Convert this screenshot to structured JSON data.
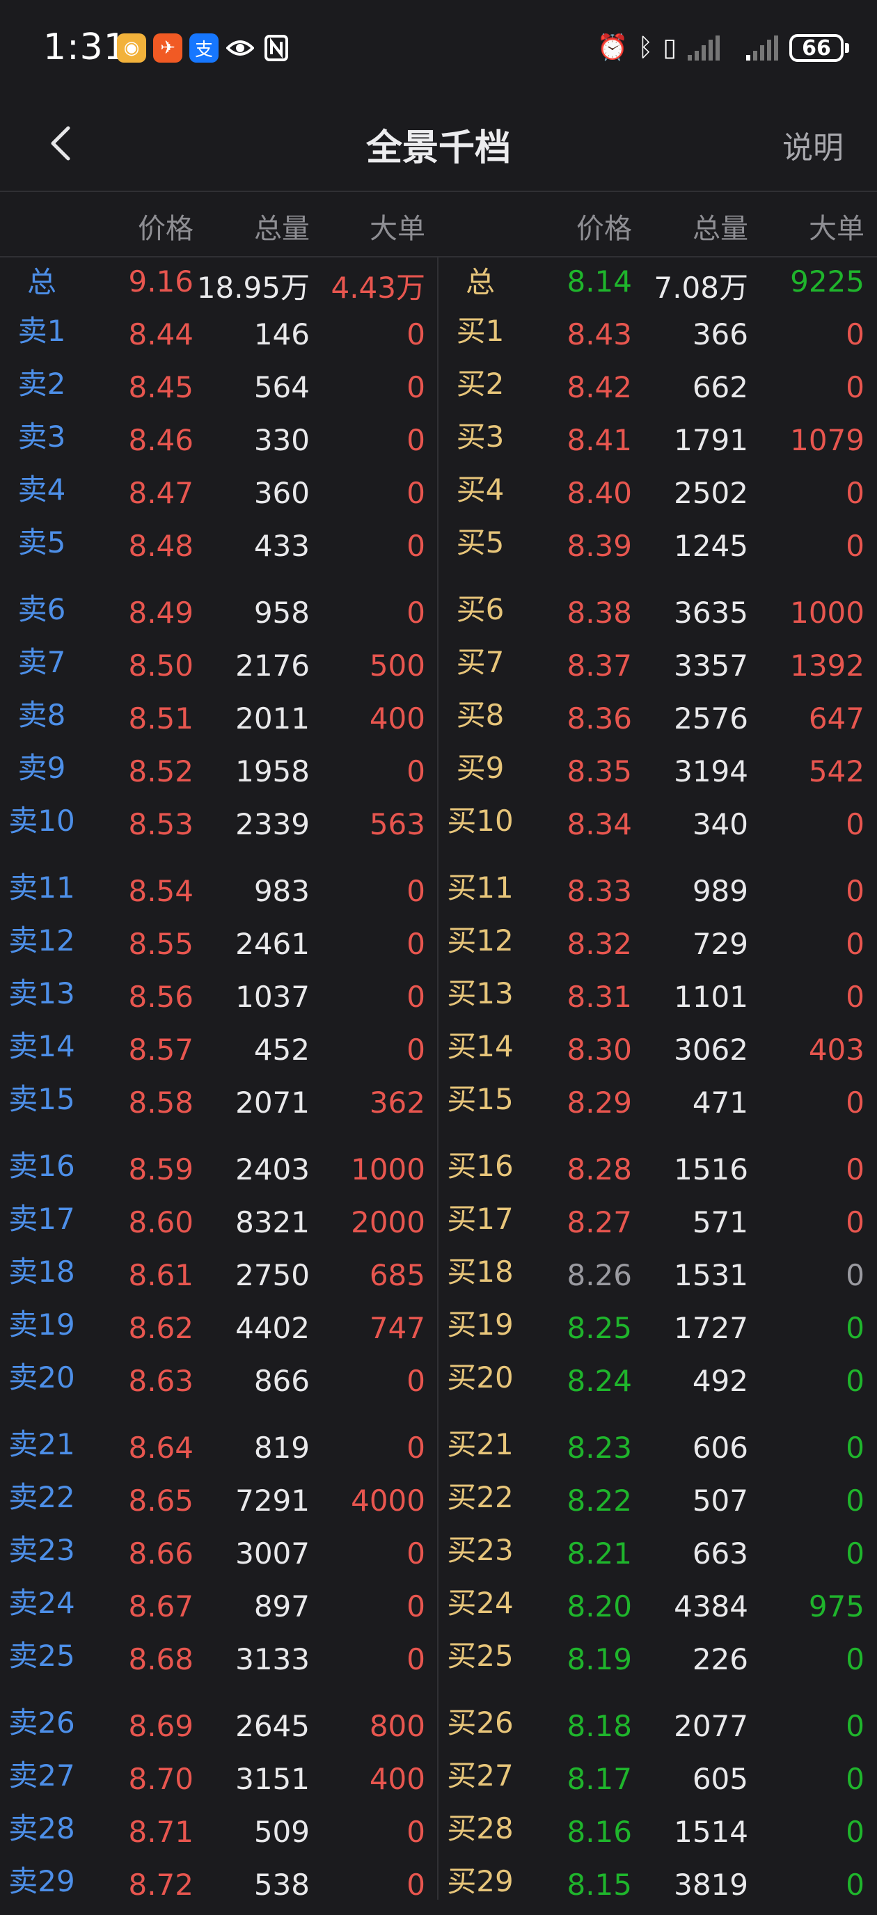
{
  "status_bar": {
    "time": "1:31",
    "battery": "66",
    "app_icons": [
      "weibo-icon",
      "red-app-icon",
      "alipay-icon",
      "eye-icon",
      "nfc-icon"
    ],
    "system_icons": [
      "alarm-icon",
      "bluetooth-icon",
      "vibrate-icon",
      "signal-icon",
      "signal-icon-2"
    ]
  },
  "nav": {
    "title": "全景千档",
    "help": "说明"
  },
  "headers": {
    "sell": {
      "price": "价格",
      "volume": "总量",
      "big": "大单"
    },
    "buy": {
      "price": "价格",
      "volume": "总量",
      "big": "大单"
    }
  },
  "colors": {
    "up": "#e8564f",
    "down": "#1fb52c",
    "flat": "#9a9aa0",
    "sell_label": "#4d8fe8",
    "buy_label": "#e7c57a"
  },
  "book": {
    "sell_total": {
      "label": "总",
      "price": "9.16",
      "volume": "18.95万",
      "big": "4.43万"
    },
    "buy_total": {
      "label": "总",
      "price": "8.14",
      "volume": "7.08万",
      "big": "9225"
    },
    "sell": [
      {
        "label": "卖1",
        "price": "8.44",
        "volume": "146",
        "big": "0"
      },
      {
        "label": "卖2",
        "price": "8.45",
        "volume": "564",
        "big": "0"
      },
      {
        "label": "卖3",
        "price": "8.46",
        "volume": "330",
        "big": "0"
      },
      {
        "label": "卖4",
        "price": "8.47",
        "volume": "360",
        "big": "0"
      },
      {
        "label": "卖5",
        "price": "8.48",
        "volume": "433",
        "big": "0"
      },
      {
        "label": "卖6",
        "price": "8.49",
        "volume": "958",
        "big": "0"
      },
      {
        "label": "卖7",
        "price": "8.50",
        "volume": "2176",
        "big": "500"
      },
      {
        "label": "卖8",
        "price": "8.51",
        "volume": "2011",
        "big": "400"
      },
      {
        "label": "卖9",
        "price": "8.52",
        "volume": "1958",
        "big": "0"
      },
      {
        "label": "卖10",
        "price": "8.53",
        "volume": "2339",
        "big": "563"
      },
      {
        "label": "卖11",
        "price": "8.54",
        "volume": "983",
        "big": "0"
      },
      {
        "label": "卖12",
        "price": "8.55",
        "volume": "2461",
        "big": "0"
      },
      {
        "label": "卖13",
        "price": "8.56",
        "volume": "1037",
        "big": "0"
      },
      {
        "label": "卖14",
        "price": "8.57",
        "volume": "452",
        "big": "0"
      },
      {
        "label": "卖15",
        "price": "8.58",
        "volume": "2071",
        "big": "362"
      },
      {
        "label": "卖16",
        "price": "8.59",
        "volume": "2403",
        "big": "1000"
      },
      {
        "label": "卖17",
        "price": "8.60",
        "volume": "8321",
        "big": "2000"
      },
      {
        "label": "卖18",
        "price": "8.61",
        "volume": "2750",
        "big": "685"
      },
      {
        "label": "卖19",
        "price": "8.62",
        "volume": "4402",
        "big": "747"
      },
      {
        "label": "卖20",
        "price": "8.63",
        "volume": "866",
        "big": "0"
      },
      {
        "label": "卖21",
        "price": "8.64",
        "volume": "819",
        "big": "0"
      },
      {
        "label": "卖22",
        "price": "8.65",
        "volume": "7291",
        "big": "4000"
      },
      {
        "label": "卖23",
        "price": "8.66",
        "volume": "3007",
        "big": "0"
      },
      {
        "label": "卖24",
        "price": "8.67",
        "volume": "897",
        "big": "0"
      },
      {
        "label": "卖25",
        "price": "8.68",
        "volume": "3133",
        "big": "0"
      },
      {
        "label": "卖26",
        "price": "8.69",
        "volume": "2645",
        "big": "800"
      },
      {
        "label": "卖27",
        "price": "8.70",
        "volume": "3151",
        "big": "400"
      },
      {
        "label": "卖28",
        "price": "8.71",
        "volume": "509",
        "big": "0"
      },
      {
        "label": "卖29",
        "price": "8.72",
        "volume": "538",
        "big": "0"
      }
    ],
    "buy": [
      {
        "label": "买1",
        "price": "8.43",
        "volume": "366",
        "big": "0",
        "dir": "up"
      },
      {
        "label": "买2",
        "price": "8.42",
        "volume": "662",
        "big": "0",
        "dir": "up"
      },
      {
        "label": "买3",
        "price": "8.41",
        "volume": "1791",
        "big": "1079",
        "dir": "up"
      },
      {
        "label": "买4",
        "price": "8.40",
        "volume": "2502",
        "big": "0",
        "dir": "up"
      },
      {
        "label": "买5",
        "price": "8.39",
        "volume": "1245",
        "big": "0",
        "dir": "up"
      },
      {
        "label": "买6",
        "price": "8.38",
        "volume": "3635",
        "big": "1000",
        "dir": "up"
      },
      {
        "label": "买7",
        "price": "8.37",
        "volume": "3357",
        "big": "1392",
        "dir": "up"
      },
      {
        "label": "买8",
        "price": "8.36",
        "volume": "2576",
        "big": "647",
        "dir": "up"
      },
      {
        "label": "买9",
        "price": "8.35",
        "volume": "3194",
        "big": "542",
        "dir": "up"
      },
      {
        "label": "买10",
        "price": "8.34",
        "volume": "340",
        "big": "0",
        "dir": "up"
      },
      {
        "label": "买11",
        "price": "8.33",
        "volume": "989",
        "big": "0",
        "dir": "up"
      },
      {
        "label": "买12",
        "price": "8.32",
        "volume": "729",
        "big": "0",
        "dir": "up"
      },
      {
        "label": "买13",
        "price": "8.31",
        "volume": "1101",
        "big": "0",
        "dir": "up"
      },
      {
        "label": "买14",
        "price": "8.30",
        "volume": "3062",
        "big": "403",
        "dir": "up"
      },
      {
        "label": "买15",
        "price": "8.29",
        "volume": "471",
        "big": "0",
        "dir": "up"
      },
      {
        "label": "买16",
        "price": "8.28",
        "volume": "1516",
        "big": "0",
        "dir": "up"
      },
      {
        "label": "买17",
        "price": "8.27",
        "volume": "571",
        "big": "0",
        "dir": "up"
      },
      {
        "label": "买18",
        "price": "8.26",
        "volume": "1531",
        "big": "0",
        "dir": "flat"
      },
      {
        "label": "买19",
        "price": "8.25",
        "volume": "1727",
        "big": "0",
        "dir": "down"
      },
      {
        "label": "买20",
        "price": "8.24",
        "volume": "492",
        "big": "0",
        "dir": "down"
      },
      {
        "label": "买21",
        "price": "8.23",
        "volume": "606",
        "big": "0",
        "dir": "down"
      },
      {
        "label": "买22",
        "price": "8.22",
        "volume": "507",
        "big": "0",
        "dir": "down"
      },
      {
        "label": "买23",
        "price": "8.21",
        "volume": "663",
        "big": "0",
        "dir": "down"
      },
      {
        "label": "买24",
        "price": "8.20",
        "volume": "4384",
        "big": "975",
        "dir": "down"
      },
      {
        "label": "买25",
        "price": "8.19",
        "volume": "226",
        "big": "0",
        "dir": "down"
      },
      {
        "label": "买26",
        "price": "8.18",
        "volume": "2077",
        "big": "0",
        "dir": "down"
      },
      {
        "label": "买27",
        "price": "8.17",
        "volume": "605",
        "big": "0",
        "dir": "down"
      },
      {
        "label": "买28",
        "price": "8.16",
        "volume": "1514",
        "big": "0",
        "dir": "down"
      },
      {
        "label": "买29",
        "price": "8.15",
        "volume": "3819",
        "big": "0",
        "dir": "down"
      }
    ]
  }
}
